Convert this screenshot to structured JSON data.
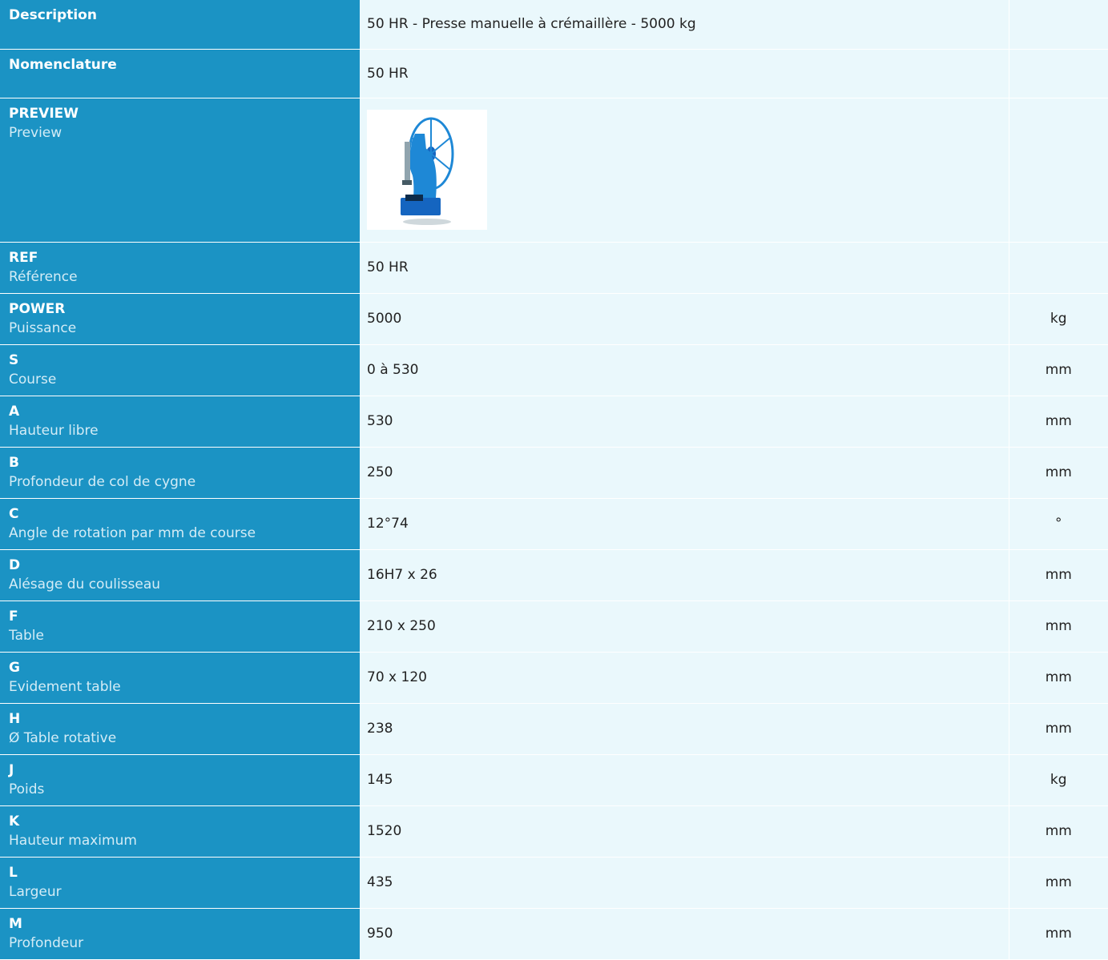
{
  "rows": [
    {
      "code": "Description",
      "name": "",
      "value": "50 HR - Presse manuelle à crémaillère - 5000 kg",
      "unit": ""
    },
    {
      "code": "Nomenclature",
      "name": "",
      "value": "50 HR",
      "unit": ""
    },
    {
      "code": "PREVIEW",
      "name": "Preview",
      "value": "",
      "unit": ""
    },
    {
      "code": "REF",
      "name": "Référence",
      "value": "50 HR",
      "unit": ""
    },
    {
      "code": "POWER",
      "name": "Puissance",
      "value": "5000",
      "unit": "kg"
    },
    {
      "code": "S",
      "name": "Course",
      "value": "0 à 530",
      "unit": "mm"
    },
    {
      "code": "A",
      "name": "Hauteur libre",
      "value": "530",
      "unit": "mm"
    },
    {
      "code": "B",
      "name": "Profondeur de col de cygne",
      "value": "250",
      "unit": "mm"
    },
    {
      "code": "C",
      "name": "Angle de rotation par mm de course",
      "value": "12°74",
      "unit": "°"
    },
    {
      "code": "D",
      "name": "Alésage du coulisseau",
      "value": "16H7 x 26",
      "unit": "mm"
    },
    {
      "code": "F",
      "name": "Table",
      "value": "210 x 250",
      "unit": "mm"
    },
    {
      "code": "G",
      "name": "Evidement table",
      "value": "70 x 120",
      "unit": "mm"
    },
    {
      "code": "H",
      "name": "Ø Table rotative",
      "value": "238",
      "unit": "mm"
    },
    {
      "code": "J",
      "name": "Poids",
      "value": "145",
      "unit": "kg"
    },
    {
      "code": "K",
      "name": "Hauteur maximum",
      "value": "1520",
      "unit": "mm"
    },
    {
      "code": "L",
      "name": "Largeur",
      "value": "435",
      "unit": "mm"
    },
    {
      "code": "M",
      "name": "Profondeur",
      "value": "950",
      "unit": "mm"
    }
  ],
  "preview_image": {
    "icon": "manual-rack-press-image",
    "color": "#1e88d6"
  },
  "colors": {
    "header_bg": "#1b93c4",
    "row_bg": "#eaf8fc",
    "text": "#222222"
  }
}
